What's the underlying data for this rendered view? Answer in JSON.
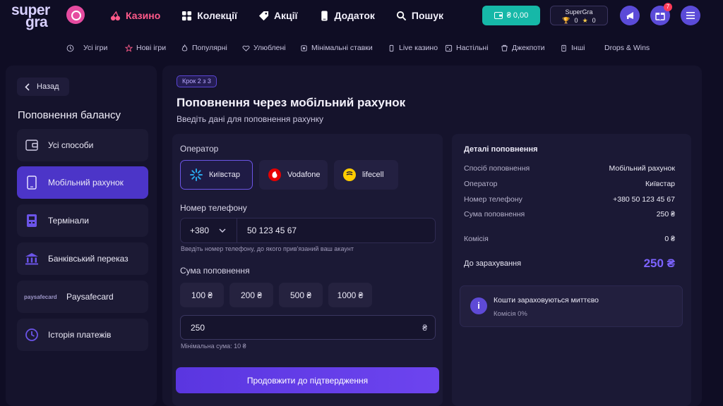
{
  "logo": {
    "line1": "super",
    "line2": "gra"
  },
  "mainnav": [
    {
      "label": "Казино",
      "icon": "cherry-icon",
      "active": true
    },
    {
      "label": "Колекції",
      "icon": "grid-icon",
      "active": false
    },
    {
      "label": "Акції",
      "icon": "tag-icon",
      "active": false
    },
    {
      "label": "Додаток",
      "icon": "phone-icon",
      "active": false
    },
    {
      "label": "Пошук",
      "icon": "search-icon",
      "active": false
    }
  ],
  "header": {
    "balance": "₴ 0,00",
    "loyalty": {
      "title": "SuperGra",
      "trophies": "0",
      "stars": "0"
    },
    "gift_badge": "7"
  },
  "subnav": [
    {
      "label": "Усі ігри",
      "icon": "history-icon"
    },
    {
      "label": "Нові ігри",
      "icon": "star-icon"
    },
    {
      "label": "Популярні",
      "icon": "fire-icon"
    },
    {
      "label": "Улюблені",
      "icon": "heart-icon"
    },
    {
      "label": "Мінімальні ставки",
      "icon": "coin-icon"
    },
    {
      "label": "Live казино",
      "icon": "live-icon"
    },
    {
      "label": "Настільні",
      "icon": "table-icon"
    },
    {
      "label": "Джекпоти",
      "icon": "jackpot-icon"
    },
    {
      "label": "Інші",
      "icon": "other-icon"
    },
    {
      "label": "Drops & Wins",
      "icon": ""
    }
  ],
  "sidebar": {
    "back": "Назад",
    "title": "Поповнення балансу",
    "items": [
      {
        "label": "Усі способи",
        "icon": "wallet-icon",
        "active": false
      },
      {
        "label": "Мобільний рахунок",
        "icon": "mobile-icon",
        "active": true
      },
      {
        "label": "Термінали",
        "icon": "terminal-icon",
        "active": false
      },
      {
        "label": "Банківський переказ",
        "icon": "bank-icon",
        "active": false
      },
      {
        "label": "Paysafecard",
        "icon": "paysafecard-logo",
        "logo_text": "paysafecard",
        "active": false
      },
      {
        "label": "Історія платежів",
        "icon": "history-icon",
        "active": false
      }
    ]
  },
  "main": {
    "step": "Крок 2 з 3",
    "title": "Поповнення через мобільний рахунок",
    "subtitle": "Введіть дані для поповнення рахунку",
    "form": {
      "operator_label": "Оператор",
      "operators": [
        {
          "label": "Київстар",
          "selected": true
        },
        {
          "label": "Vodafone",
          "selected": false
        },
        {
          "label": "lifecell",
          "selected": false
        }
      ],
      "phone_label": "Номер телефону",
      "phone_code": "+380",
      "phone_value": "50 123 45 67",
      "phone_hint": "Введіть номер телефону, до якого прив'язаний ваш акаунт",
      "amount_label": "Сума поповнення",
      "presets": [
        "100 ₴",
        "200 ₴",
        "500 ₴",
        "1000 ₴"
      ],
      "amount_value": "250",
      "currency": "₴",
      "min_hint": "Мінімальна сума: 10 ₴",
      "submit": "Продовжити до підтвердження"
    },
    "details": {
      "title": "Деталі поповнення",
      "rows": [
        {
          "k": "Спосіб поповнення",
          "v": "Мобільний рахунок"
        },
        {
          "k": "Оператор",
          "v": "Київстар"
        },
        {
          "k": "Номер телефону",
          "v": "+380 50 123 45 67"
        },
        {
          "k": "Сума поповнення",
          "v": "250 ₴"
        }
      ],
      "commission": {
        "k": "Комісія",
        "v": "0 ₴"
      },
      "total": {
        "k": "До зарахування",
        "v": "250 ₴"
      },
      "info_title": "Кошти зараховуються миттєво",
      "info_sub": "Комісія 0%"
    }
  },
  "colors": {
    "accent": "#5b46d6",
    "total": "#7c63ff",
    "active_nav": "#ff5a8a",
    "balance": "#16b8a8"
  }
}
